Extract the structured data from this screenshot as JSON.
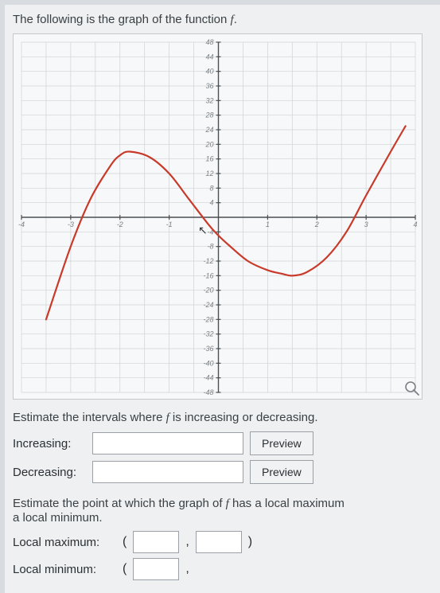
{
  "prompt": {
    "line1_pre": "The following is the graph of the function ",
    "fn_symbol": "f",
    "line1_post": "."
  },
  "chart_data": {
    "type": "line",
    "xlabel": "",
    "ylabel": "",
    "xlim": [
      -4,
      4
    ],
    "ylim": [
      -48,
      48
    ],
    "x_ticks": [
      -4,
      -3,
      -2,
      -1,
      0,
      1,
      2,
      3,
      4
    ],
    "y_ticks": [
      -48,
      -44,
      -40,
      -36,
      -32,
      -28,
      -24,
      -20,
      -16,
      -12,
      -8,
      -4,
      0,
      4,
      8,
      12,
      16,
      20,
      24,
      28,
      32,
      36,
      40,
      44,
      48
    ],
    "series": [
      {
        "name": "f",
        "color": "#c83a2a",
        "x": [
          -3.5,
          -3.0,
          -2.6,
          -2.2,
          -2.0,
          -1.8,
          -1.4,
          -1.0,
          -0.6,
          -0.2,
          0.0,
          0.2,
          0.6,
          1.0,
          1.3,
          1.5,
          1.8,
          2.2,
          2.6,
          3.0,
          3.5,
          3.8
        ],
        "y": [
          -28.0,
          -8.0,
          5.0,
          14.0,
          17.0,
          18.0,
          16.5,
          12.0,
          5.0,
          -2.0,
          -5.0,
          -7.5,
          -12.0,
          -14.5,
          -15.5,
          -16.0,
          -15.0,
          -11.0,
          -4.0,
          6.0,
          18.0,
          25.0
        ]
      }
    ],
    "local_maximum_estimate": {
      "x": -2,
      "y": 18
    },
    "local_minimum_estimate": {
      "x": 1.5,
      "y": -16
    }
  },
  "q_intervals": {
    "prompt_pre": "Estimate the intervals where ",
    "fn_symbol": "f",
    "prompt_post": " is increasing or decreasing.",
    "increasing_label": "Increasing:",
    "decreasing_label": "Decreasing:",
    "preview_label": "Preview",
    "increasing_value": "",
    "decreasing_value": ""
  },
  "q_extrema": {
    "prompt_pre": "Estimate the point at which the graph of ",
    "fn_symbol": "f",
    "prompt_post": " has a local maximum",
    "prompt_line2": "a local minimum.",
    "local_max_label": "Local maximum:",
    "local_min_label": "Local minimum:",
    "lparen": "(",
    "comma": ",",
    "rparen": ")",
    "max_x": "",
    "max_y": "",
    "min_x": "",
    "min_y": ""
  }
}
